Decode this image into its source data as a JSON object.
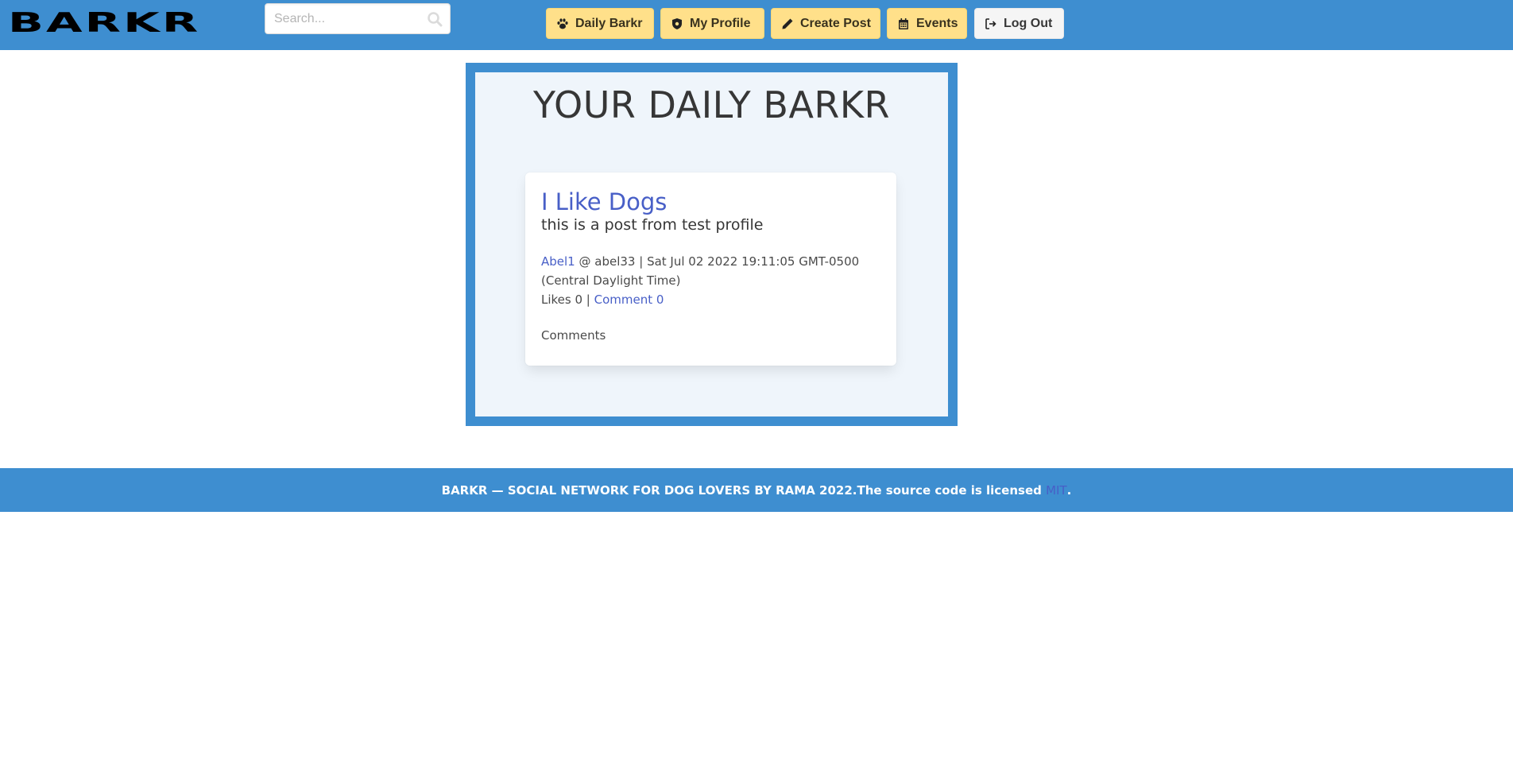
{
  "brand": {
    "logo_text": "BARKR"
  },
  "search": {
    "placeholder": "Search...",
    "value": ""
  },
  "nav": {
    "items": [
      {
        "label": "Daily Barkr",
        "icon": "paw-icon"
      },
      {
        "label": "My Profile",
        "icon": "shield-dog-icon"
      },
      {
        "label": "Create Post",
        "icon": "pencil-icon"
      },
      {
        "label": "Events",
        "icon": "calendar-icon"
      },
      {
        "label": "Log Out",
        "icon": "sign-out-icon"
      }
    ]
  },
  "main": {
    "title": "YOUR DAILY BARKR",
    "post": {
      "title": "I Like Dogs",
      "body": "this is a post from test profile",
      "author_name": "Abel1",
      "author_handle": "@ abel33 | Sat Jul 02 2022 19:11:05 GMT-0500",
      "timezone": "(Central Daylight Time)",
      "likes_text": "Likes 0 |",
      "comment_link": "Comment 0",
      "comments_label": "Comments"
    }
  },
  "footer": {
    "text": "BARKR — SOCIAL NETWORK FOR DOG LOVERS BY RAMA 2022.The source code is licensed",
    "license_link": "MIT",
    "end": "."
  },
  "colors": {
    "primary": "#3e8ed0",
    "warning": "#ffe08a",
    "link": "#485fc7",
    "panel_bg": "#eff5fb"
  }
}
